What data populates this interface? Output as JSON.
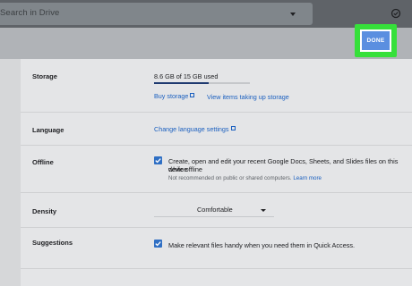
{
  "search": {
    "placeholder": "Search in Drive"
  },
  "header": {
    "done_label": "DONE"
  },
  "storage": {
    "label": "Storage",
    "usage_text": "8.6 GB of 15 GB used",
    "used_fraction": 0.573,
    "buy_link": "Buy storage",
    "view_link": "View items taking up storage"
  },
  "language": {
    "label": "Language",
    "link": "Change language settings"
  },
  "offline": {
    "label": "Offline",
    "checked": true,
    "description_line1": "Create, open and edit your recent Google Docs, Sheets, and Slides files on this device",
    "description_line2": "while offline",
    "note": "Not recommended on public or shared computers.",
    "note_link": "Learn more"
  },
  "density": {
    "label": "Density",
    "selected": "Comfortable"
  },
  "suggestions": {
    "label": "Suggestions",
    "checked": true,
    "description": "Make relevant files handy when you need them in Quick Access."
  },
  "colors": {
    "accent": "#2f6fc4",
    "done_highlight": "#36e03a",
    "link": "#1a5fbf"
  },
  "icons": {
    "sync": "sync-check-icon",
    "external": "open-in-new-icon",
    "checkbox": "check-icon",
    "dropdown": "caret-down-icon"
  }
}
